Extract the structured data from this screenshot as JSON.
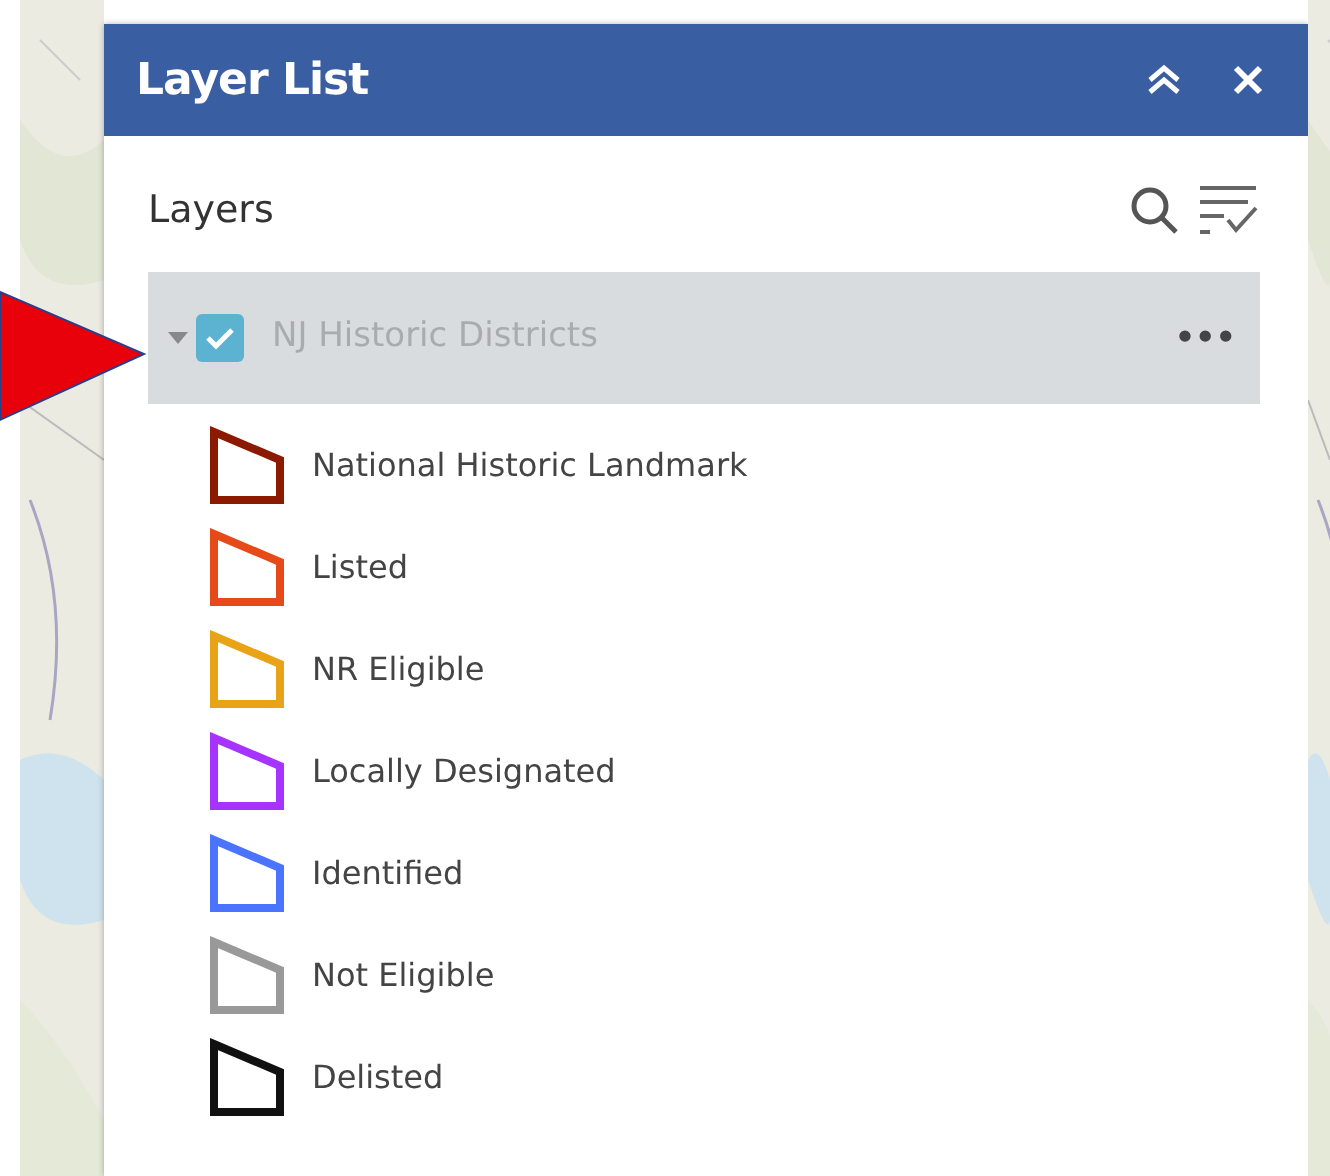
{
  "panel": {
    "title": "Layer List"
  },
  "section": {
    "title": "Layers"
  },
  "layer": {
    "name": "NJ Historic Districts",
    "checked": true,
    "expanded": true,
    "more": "•••"
  },
  "legend": [
    {
      "label": "National Historic Landmark",
      "color": "#8b1a00"
    },
    {
      "label": "Listed",
      "color": "#e64a19"
    },
    {
      "label": "NR Eligible",
      "color": "#e8a317"
    },
    {
      "label": "Locally Designated",
      "color": "#a633ff"
    },
    {
      "label": "Identified",
      "color": "#4a73ff"
    },
    {
      "label": "Not Eligible",
      "color": "#999999"
    },
    {
      "label": "Delisted",
      "color": "#111111"
    }
  ]
}
